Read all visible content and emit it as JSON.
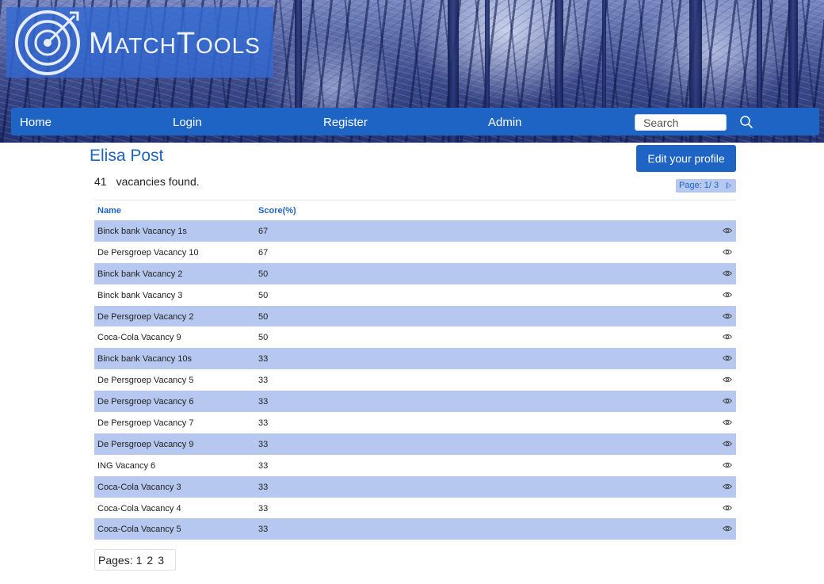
{
  "brand": {
    "logo_first": "M",
    "logo_rest_1": "ATCH",
    "logo_mid": "T",
    "logo_rest_2": "OOLS"
  },
  "nav": {
    "items": [
      {
        "label": "Home"
      },
      {
        "label": "Login"
      },
      {
        "label": "Register"
      },
      {
        "label": "Admin"
      }
    ],
    "search_placeholder": "Search"
  },
  "profile": {
    "name": "Elisa Post",
    "edit_label": "Edit your profile"
  },
  "results": {
    "count": "41",
    "count_text": "vacancies found.",
    "page_indicator": "Page: 1/ 3"
  },
  "table": {
    "headers": {
      "name": "Name",
      "score": "Score(%)"
    },
    "rows": [
      {
        "name": "Binck bank Vacancy 1s",
        "score": "67"
      },
      {
        "name": "De Persgroep Vacancy 10",
        "score": "67"
      },
      {
        "name": "Binck bank Vacancy 2",
        "score": "50"
      },
      {
        "name": "Binck bank Vacancy 3",
        "score": "50"
      },
      {
        "name": "De Persgroep Vacancy 2",
        "score": "50"
      },
      {
        "name": "Coca-Cola Vacancy 9",
        "score": "50"
      },
      {
        "name": "Binck bank Vacancy 10s",
        "score": "33"
      },
      {
        "name": "De Persgroep Vacancy 5",
        "score": "33"
      },
      {
        "name": "De Persgroep Vacancy 6",
        "score": "33"
      },
      {
        "name": "De Persgroep Vacancy 7",
        "score": "33"
      },
      {
        "name": "De Persgroep Vacancy 9",
        "score": "33"
      },
      {
        "name": "ING Vacancy 6",
        "score": "33"
      },
      {
        "name": "Coca-Cola Vacancy 3",
        "score": "33"
      },
      {
        "name": "Coca-Cola Vacancy 4",
        "score": "33"
      },
      {
        "name": "Coca-Cola Vacancy 5",
        "score": "33"
      }
    ]
  },
  "pagination": {
    "label": "Pages:",
    "pages": [
      "1",
      "2",
      "3"
    ]
  },
  "icons": {
    "search": "search-icon",
    "view": "eye-icon",
    "logo": "target-logo-icon",
    "next": "triangle-right-icon"
  },
  "colors": {
    "primary": "#1d64c4",
    "row_highlight": "#b6c8ef",
    "logo_box": "#3269d2"
  }
}
